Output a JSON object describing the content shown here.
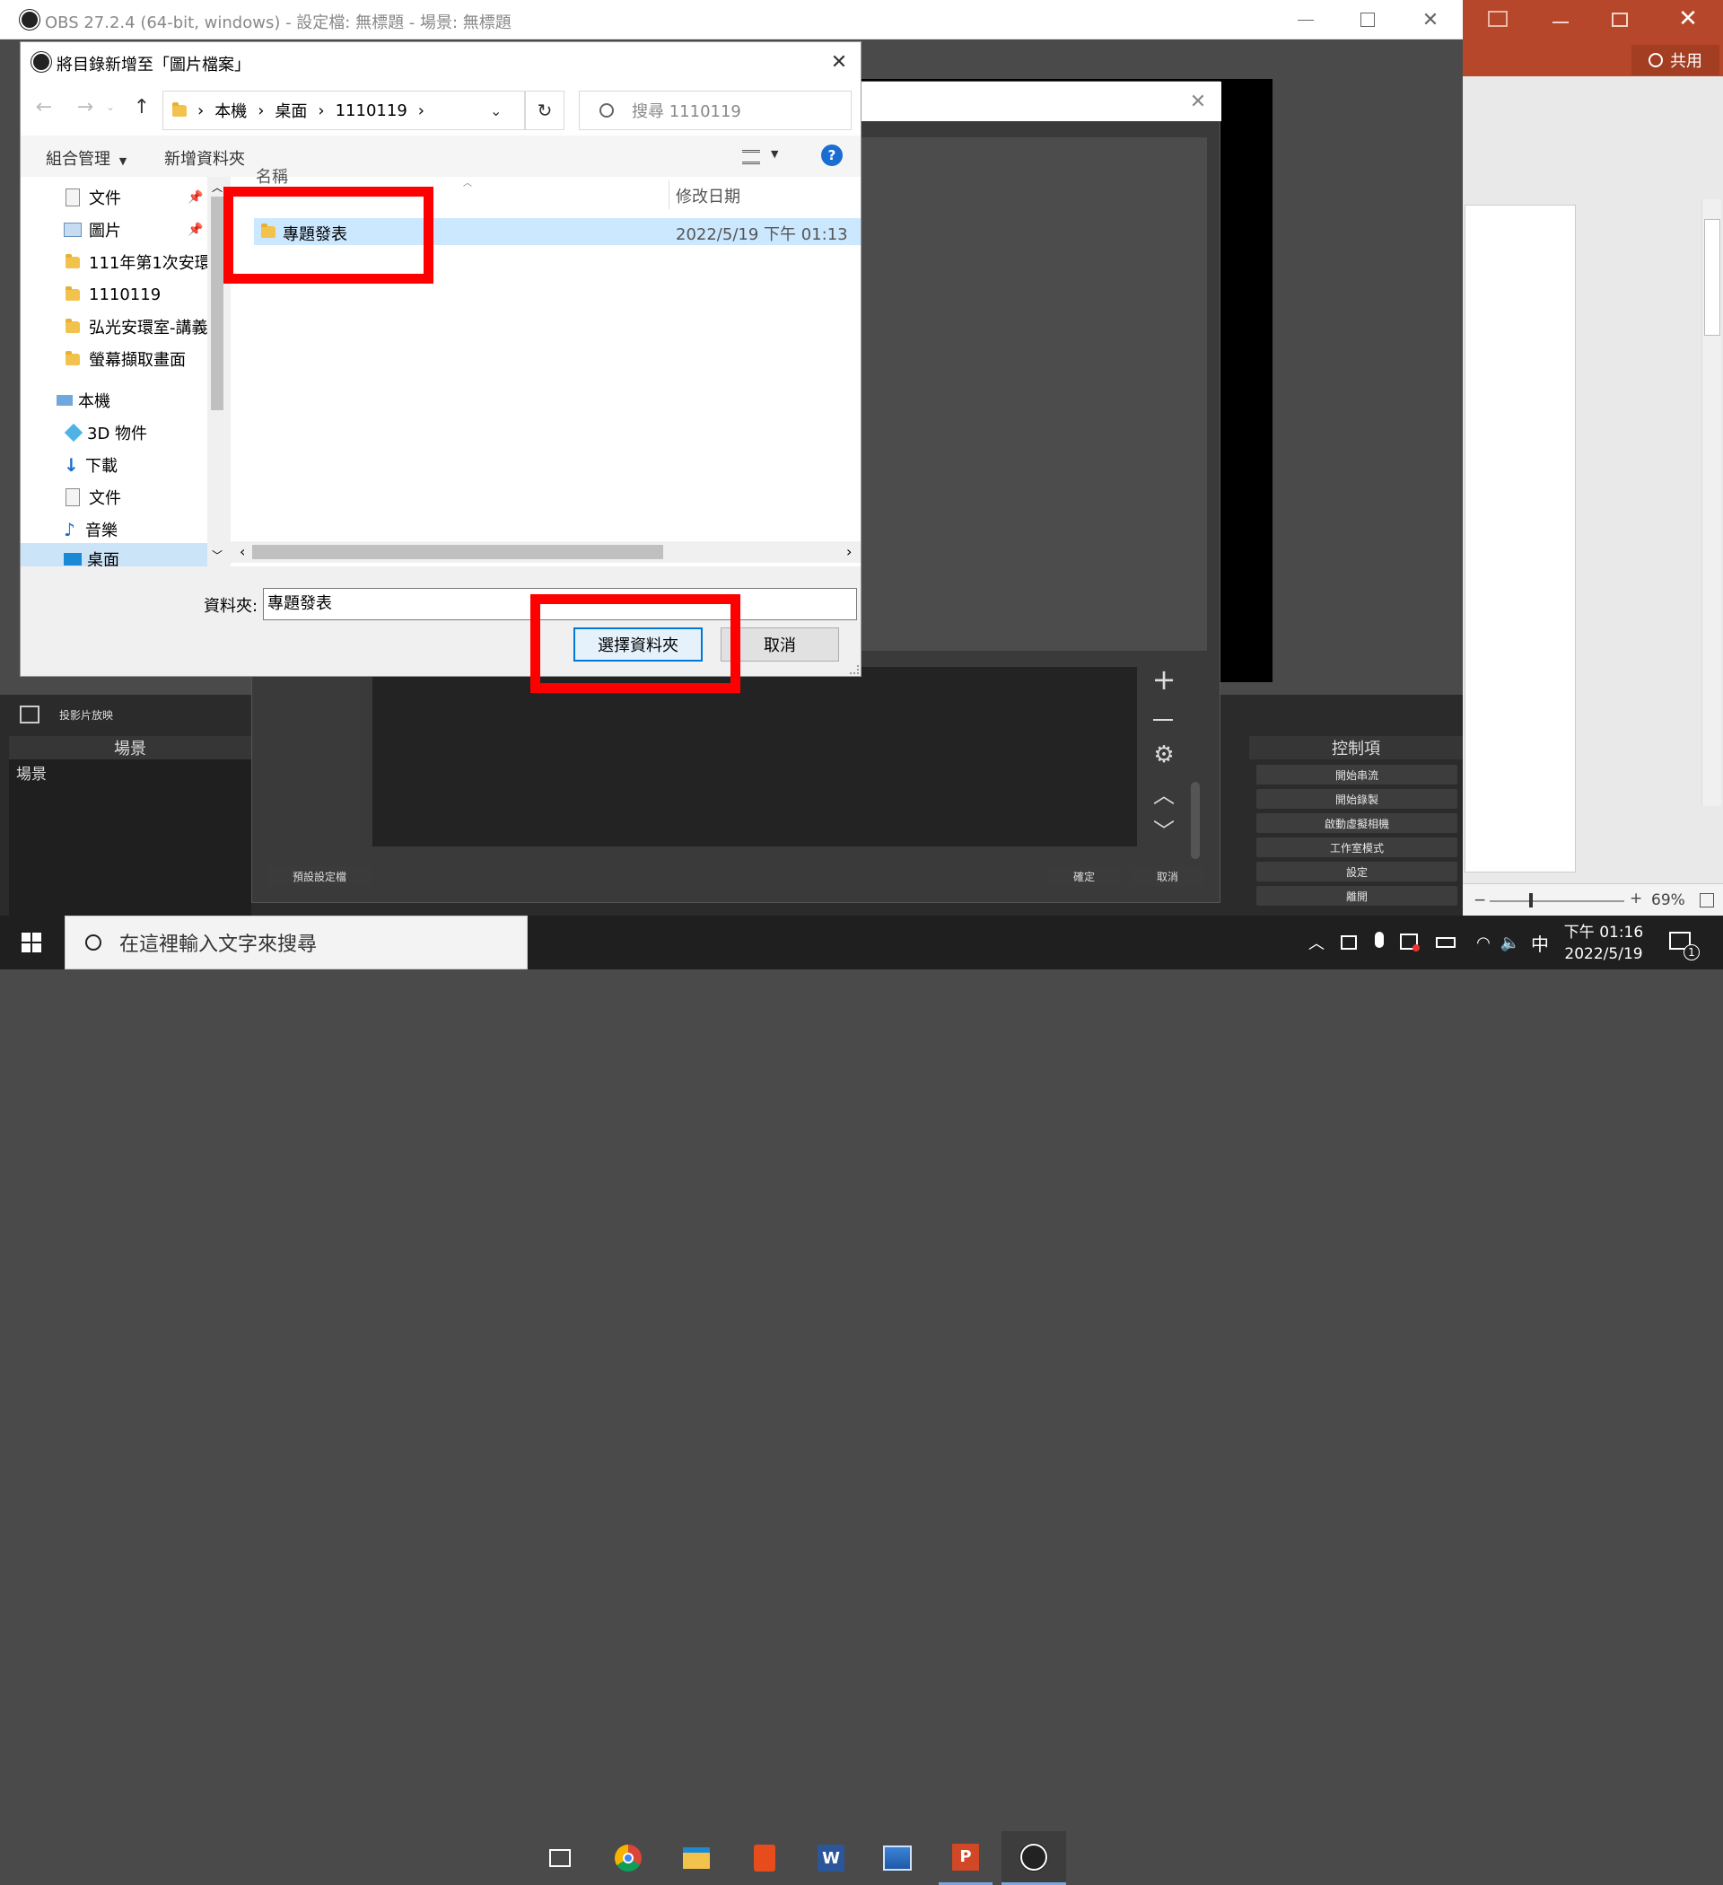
{
  "obs": {
    "title": "OBS 27.2.4 (64-bit, windows) - 設定檔: 無標題 - 場景: 無標題",
    "slideshow_label": "投影片放映",
    "scenes_header": "場景",
    "scene_item": "場景",
    "controls_header": "控制項",
    "controls": [
      "開始串流",
      "開始錄製",
      "啟動虛擬相機",
      "工作室模式",
      "設定",
      "離開"
    ],
    "prop_defaults_btn": "預設設定檔",
    "prop_ok_btn": "確定",
    "prop_cancel_btn": "取消"
  },
  "ppt": {
    "share_label": "共用",
    "zoom": "69%"
  },
  "dialog": {
    "title": "將目錄新增至「圖片檔案」",
    "breadcrumb": [
      "本機",
      "桌面",
      "1110119"
    ],
    "search_placeholder": "搜尋 1110119",
    "organize": "組合管理",
    "new_folder": "新增資料夾",
    "nav": {
      "quick": [
        "文件",
        "圖片",
        "111年第1次安環",
        "1110119",
        "弘光安環室-講義",
        "螢幕擷取畫面"
      ],
      "this_pc": "本機",
      "pc_items": [
        "3D 物件",
        "下載",
        "文件",
        "音樂",
        "桌面"
      ]
    },
    "columns": {
      "name": "名稱",
      "modified": "修改日期"
    },
    "files": [
      {
        "name": "專題發表",
        "modified": "2022/5/19 下午 01:13"
      }
    ],
    "folder_label": "資料夾:",
    "folder_value": "專題發表",
    "select_btn": "選擇資料夾",
    "cancel_btn": "取消"
  },
  "taskbar": {
    "search_placeholder": "在這裡輸入文字來搜尋",
    "ime": "中",
    "time": "下午 01:16",
    "date": "2022/5/19",
    "notification_count": "1"
  }
}
